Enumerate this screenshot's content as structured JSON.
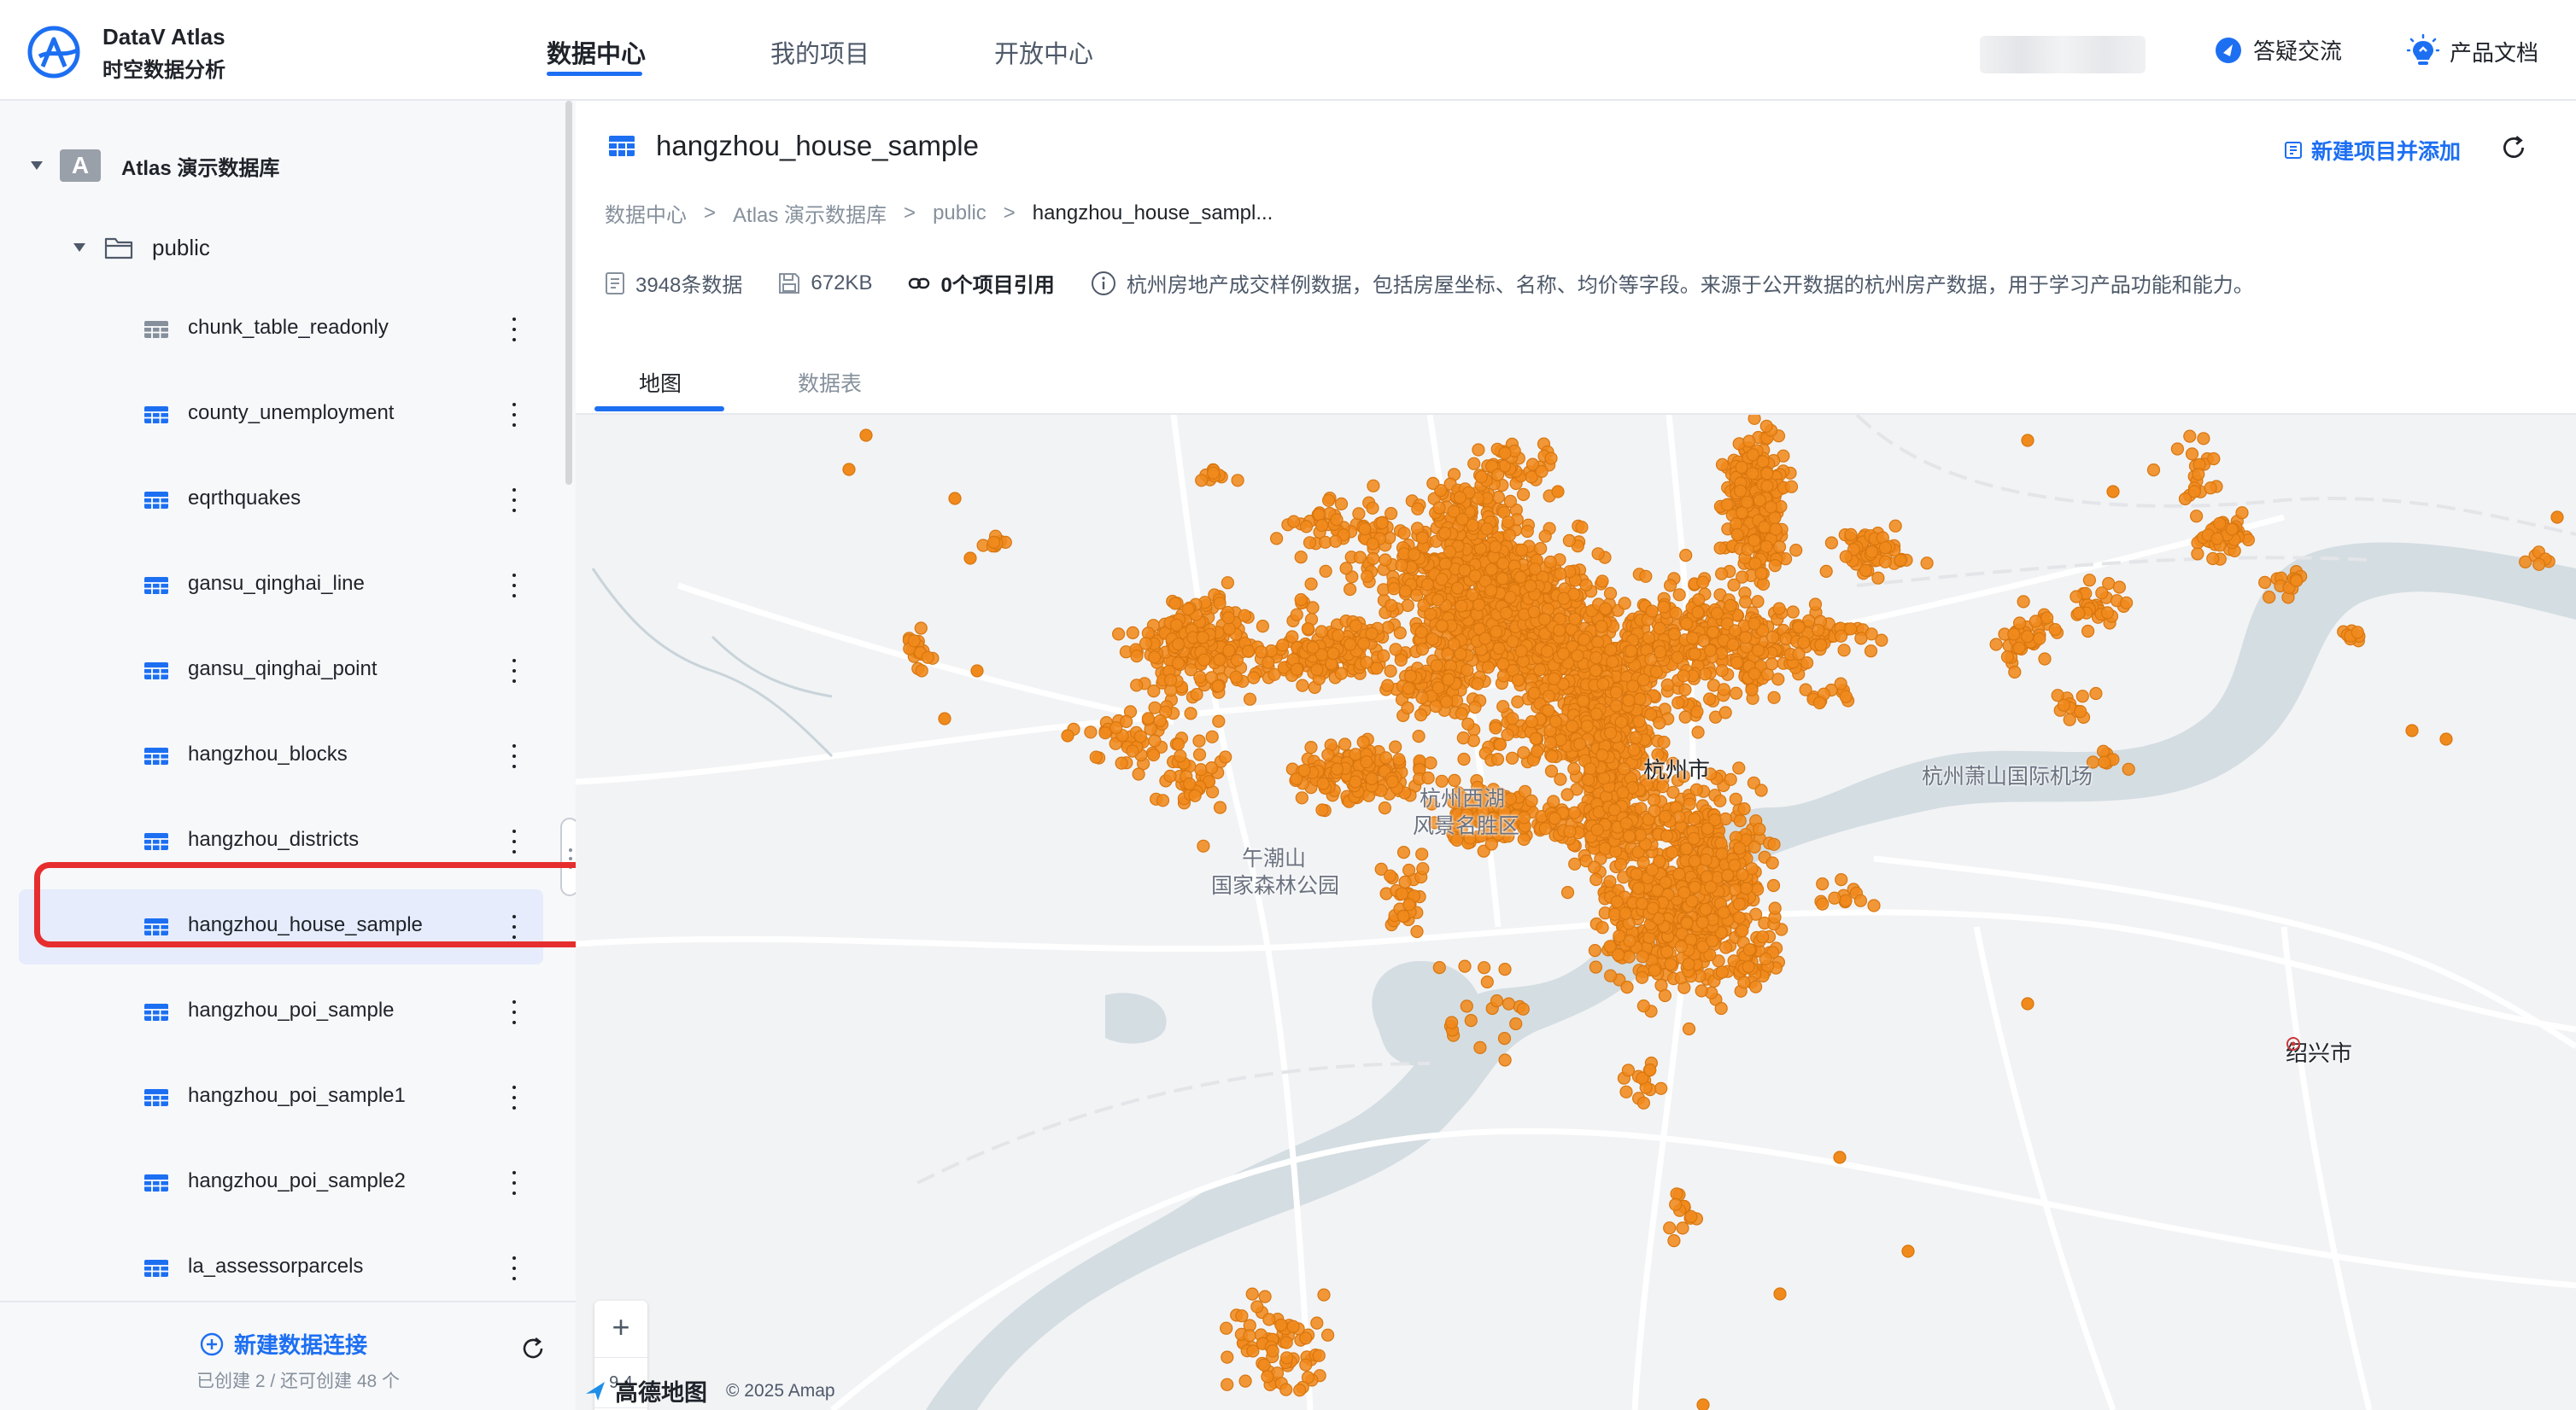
{
  "app": {
    "name": "DataV Atlas",
    "subtitle": "时空数据分析"
  },
  "nav": {
    "tabs": [
      {
        "label": "数据中心"
      },
      {
        "label": "我的项目"
      },
      {
        "label": "开放中心"
      }
    ]
  },
  "header": {
    "qa_label": "答疑交流",
    "docs_label": "产品文档"
  },
  "sidebar": {
    "database": {
      "badge": "A",
      "label": "Atlas 演示数据库"
    },
    "folder": {
      "label": "public"
    },
    "tables": [
      {
        "label": "chunk_table_readonly"
      },
      {
        "label": "county_unemployment"
      },
      {
        "label": "eqrthquakes"
      },
      {
        "label": "gansu_qinghai_line"
      },
      {
        "label": "gansu_qinghai_point"
      },
      {
        "label": "hangzhou_blocks"
      },
      {
        "label": "hangzhou_districts"
      },
      {
        "label": "hangzhou_house_sample"
      },
      {
        "label": "hangzhou_poi_sample"
      },
      {
        "label": "hangzhou_poi_sample1"
      },
      {
        "label": "hangzhou_poi_sample2"
      },
      {
        "label": "la_assessorparcels"
      }
    ],
    "selected_table": "hangzhou_house_sample",
    "new_connection_label": "新建数据连接",
    "quota_text": "已创建 2 / 还可创建 48 个"
  },
  "dataset": {
    "title": "hangzhou_house_sample",
    "new_project_label": "新建项目并添加",
    "breadcrumb": [
      "数据中心",
      "Atlas 演示数据库",
      "public",
      "hangzhou_house_sampl..."
    ],
    "breadcrumb_sep": ">",
    "row_count": "3948条数据",
    "size": "672KB",
    "project_refs": "0个项目引用",
    "description": "杭州房地产成交样例数据，包括房屋坐标、名称、均价等字段。来源于公开数据的杭州房产数据，用于学习产品功能和能力。"
  },
  "tabs": [
    {
      "label": "地图"
    },
    {
      "label": "数据表"
    }
  ],
  "map": {
    "zoom_in": "+",
    "zoom_level": "9.4",
    "zoom_out": "—",
    "provider": "高德地图",
    "copyright": "© 2025 Amap",
    "labels": {
      "hangzhou_city": "杭州市",
      "west_lake_1": "杭州西湖",
      "west_lake_2": "风景名胜区",
      "wuchaoshan_1": "午潮山",
      "wuchaoshan_2": "国家森林公园",
      "airport": "杭州萧山国际机场",
      "shaoxing": "绍兴市"
    },
    "point_color": "#f08a1c",
    "point_stroke": "#d8760e"
  },
  "colors": {
    "accent": "#1d6ff2",
    "highlight": "#e62e2e",
    "selected_bg": "#e6ecfb"
  }
}
